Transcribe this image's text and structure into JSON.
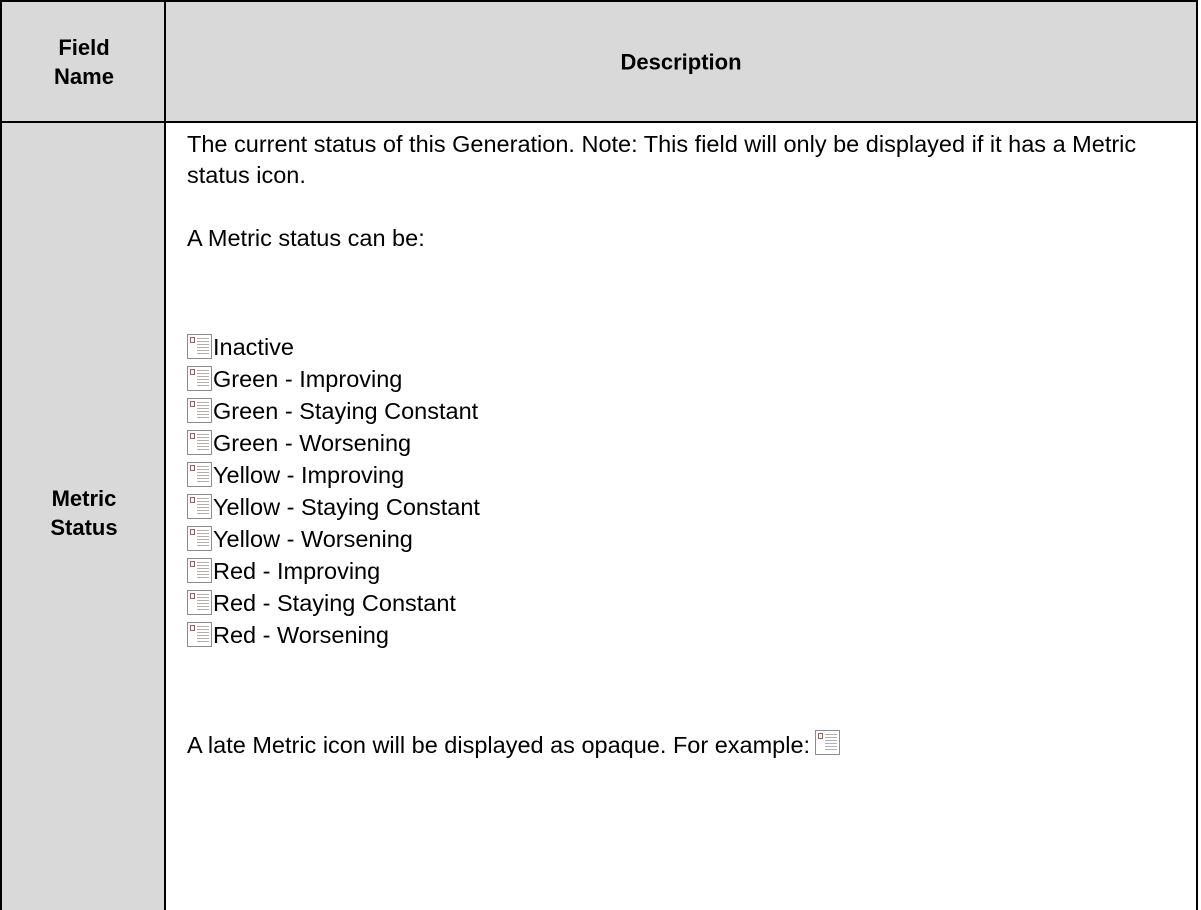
{
  "table": {
    "headers": {
      "field_name": "Field Name",
      "description": "Description"
    },
    "row": {
      "field_name": "Metric Status",
      "intro": "The current status of this Generation. Note: This field will only be displayed if it has a Metric status icon.",
      "status_lead": "A Metric status can be:",
      "statuses": [
        "Inactive",
        "Green - Improving",
        "Green - Staying Constant",
        "Green - Worsening",
        "Yellow - Improving",
        "Yellow - Staying Constant",
        "Yellow - Worsening",
        "Red - Improving",
        "Red - Staying Constant",
        "Red - Worsening"
      ],
      "late_note": "A late Metric icon will be displayed as opaque. For example:"
    }
  },
  "icons": {
    "status_icon": "broken-image-icon"
  },
  "colors": {
    "header_bg": "#d9d9d9",
    "field_col_bg": "#d9d9d9",
    "border": "#000000"
  }
}
